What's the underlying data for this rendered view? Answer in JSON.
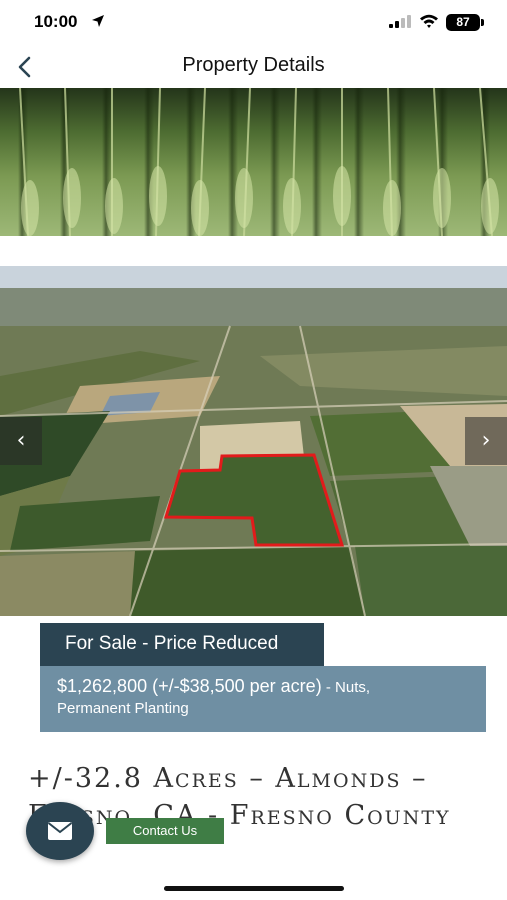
{
  "status_bar": {
    "time": "10:00",
    "battery": "87"
  },
  "nav": {
    "back_icon": "chevron-left-icon",
    "title": "Property Details"
  },
  "carousel": {
    "prev_icon": "chevron-left-icon",
    "next_icon": "chevron-right-icon",
    "prev_glyph": "‹",
    "next_glyph": "›"
  },
  "listing": {
    "status": "For Sale - Price Reduced",
    "price": "$1,262,800 (+/-$38,500 per acre)",
    "price_tags_1": " - Nuts,",
    "price_tags_2": "Permanent Planting",
    "title": "+/-32.8 Acres – Almonds – Fresno, CA - Fresno County"
  },
  "contact": {
    "icon": "mail-icon",
    "label": "Contact Us"
  },
  "colors": {
    "badge": "#2b4452",
    "price_box": "#6f8fa3",
    "contact": "#3f7d45",
    "boundary": "#e21b1b"
  }
}
